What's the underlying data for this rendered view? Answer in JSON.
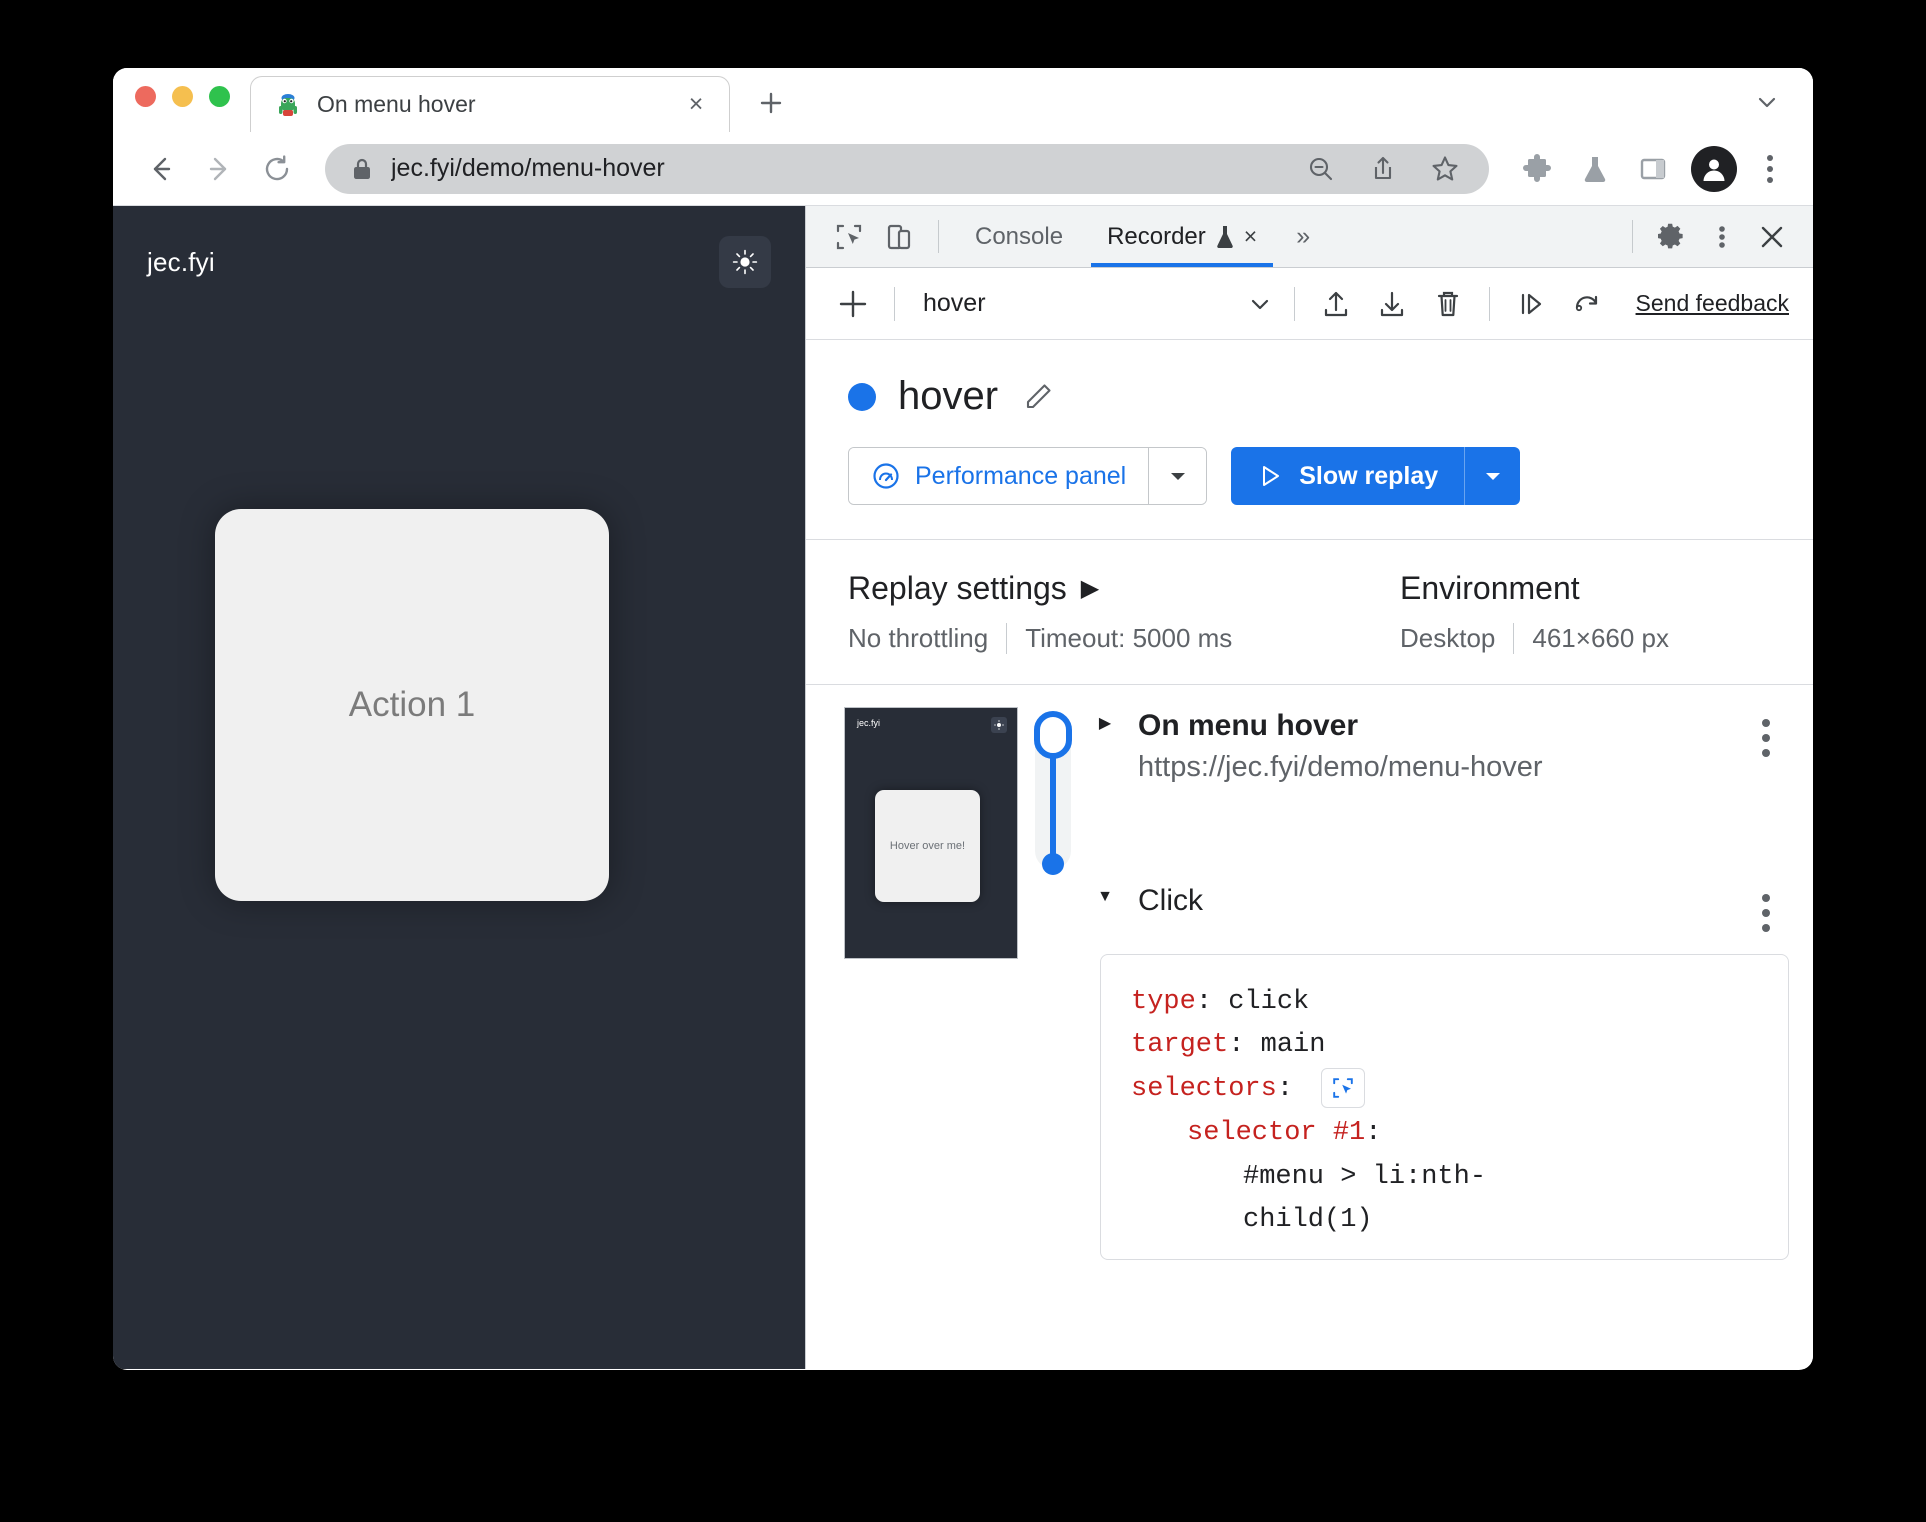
{
  "browser": {
    "tab": {
      "title": "On menu hover",
      "favicon": "puppeteer-icon",
      "close_label": "×"
    },
    "new_tab_label": "+",
    "tabstrip_chevron": "chevron-down-icon",
    "nav": {
      "back": "back-arrow-icon",
      "forward": "forward-arrow-icon",
      "reload": "reload-icon"
    },
    "omnibox": {
      "lock": "lock-icon",
      "url": "jec.fyi/demo/menu-hover",
      "zoom_out": "zoom-out-icon",
      "share": "share-icon",
      "bookmark": "star-icon"
    },
    "toolbar_icons": [
      "puzzle-piece-icon",
      "flask-icon",
      "side-panel-icon"
    ],
    "profile": "account-avatar-icon",
    "menu": "three-dot-menu-icon"
  },
  "page": {
    "brand": "jec.fyi",
    "theme_toggle": "sun-icon",
    "card_label": "Action 1"
  },
  "devtools": {
    "inspect_icon": "inspect-element-icon",
    "device_icon": "device-toolbar-icon",
    "tabs": [
      {
        "label": "Console",
        "selected": false
      },
      {
        "label": "Recorder",
        "selected": true,
        "experiment_icon": "flask-icon",
        "close": "×"
      }
    ],
    "more_tabs": "»",
    "settings_icon": "gear-icon",
    "kebab_icon": "three-dot-menu-icon",
    "close_icon": "close-icon"
  },
  "recorder": {
    "toolbar": {
      "add": "plus-icon",
      "selected_recording": "hover",
      "chevron": "chevron-down-icon",
      "import": "import-icon",
      "export": "export-icon",
      "delete": "trash-icon",
      "step_replay": "step-replay-icon",
      "replay_again": "replay-again-icon",
      "feedback": "Send feedback"
    },
    "header": {
      "status_dot_color": "#1a73e8",
      "title": "hover",
      "edit_icon": "pencil-icon",
      "perf_button": "Performance panel",
      "perf_icon": "performance-gauge-icon",
      "perf_arrow": "▾",
      "replay_button": "Slow replay",
      "replay_icon": "play-icon",
      "replay_arrow": "▾"
    },
    "settings": {
      "replay_settings_label": "Replay settings",
      "replay_settings_caret": "▶",
      "throttling": "No throttling",
      "timeout": "Timeout: 5000 ms",
      "environment_label": "Environment",
      "device": "Desktop",
      "viewport": "461×660 px"
    },
    "thumbnail": {
      "brand": "jec.fyi",
      "toggle": "sun-icon",
      "card_label": "Hover over me!"
    },
    "steps": [
      {
        "caret": "▶",
        "title": "On menu hover",
        "url": "https://jec.fyi/demo/menu-hover",
        "kebab": "three-dot-menu-icon",
        "expanded": false
      },
      {
        "caret": "▼",
        "title": "Click",
        "kebab": "three-dot-menu-icon",
        "expanded": true,
        "details": {
          "type_key": "type",
          "type_value": "click",
          "target_key": "target",
          "target_value": "main",
          "selectors_key": "selectors",
          "selector_pick_icon": "inspect-element-icon",
          "selector_1_key": "selector #1",
          "selector_1_value_line1": "#menu > li:nth-",
          "selector_1_value_line2": "child(1)"
        }
      }
    ]
  },
  "colors": {
    "accent": "#1a73e8",
    "page_bg": "#282d37",
    "card_bg": "#f0f0f0",
    "code_key": "#c5221f"
  }
}
